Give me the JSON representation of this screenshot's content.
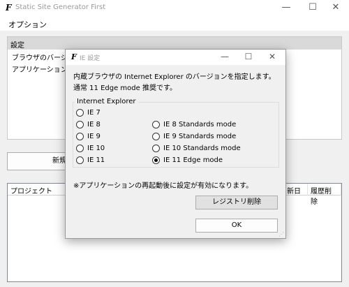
{
  "main_window": {
    "title": "Static Site Generator First",
    "logo_text": "F",
    "controls": {
      "minimize": "—",
      "maximize": "☐",
      "close": "✕"
    }
  },
  "menu": {
    "options_label": "オプション"
  },
  "settings": {
    "header": "設定",
    "items": [
      "ブラウザのバージ",
      "アプリケーション"
    ]
  },
  "new_button_label": "新規プロ",
  "project_table": {
    "columns": [
      "プロジェクト",
      "新日",
      "履歴削除"
    ]
  },
  "dialog": {
    "title": "IE 設定",
    "logo_text": "F",
    "controls": {
      "minimize": "—",
      "maximize": "☐",
      "close": "✕"
    },
    "description_line1": "内蔵ブラウザの Internet Explorer のバージョンを指定します。",
    "description_line2": "通常 11 Edge mode 推奨です。",
    "group_label": "Internet Explorer",
    "options": [
      {
        "label": "IE 7",
        "checked": false
      },
      {
        "label": "IE 8",
        "checked": false
      },
      {
        "label": "IE 9",
        "checked": false
      },
      {
        "label": "IE 10",
        "checked": false
      },
      {
        "label": "IE 11",
        "checked": false
      },
      {
        "label": "IE 8 Standards mode",
        "checked": false
      },
      {
        "label": "IE 9 Standards mode",
        "checked": false
      },
      {
        "label": "IE 10 Standards mode",
        "checked": false
      },
      {
        "label": "IE 11 Edge mode",
        "checked": true
      }
    ],
    "note": "※アプリケーションの再起動後に設定が有効になります。",
    "registry_button_label": "レジストリ削除",
    "ok_button_label": "OK"
  }
}
